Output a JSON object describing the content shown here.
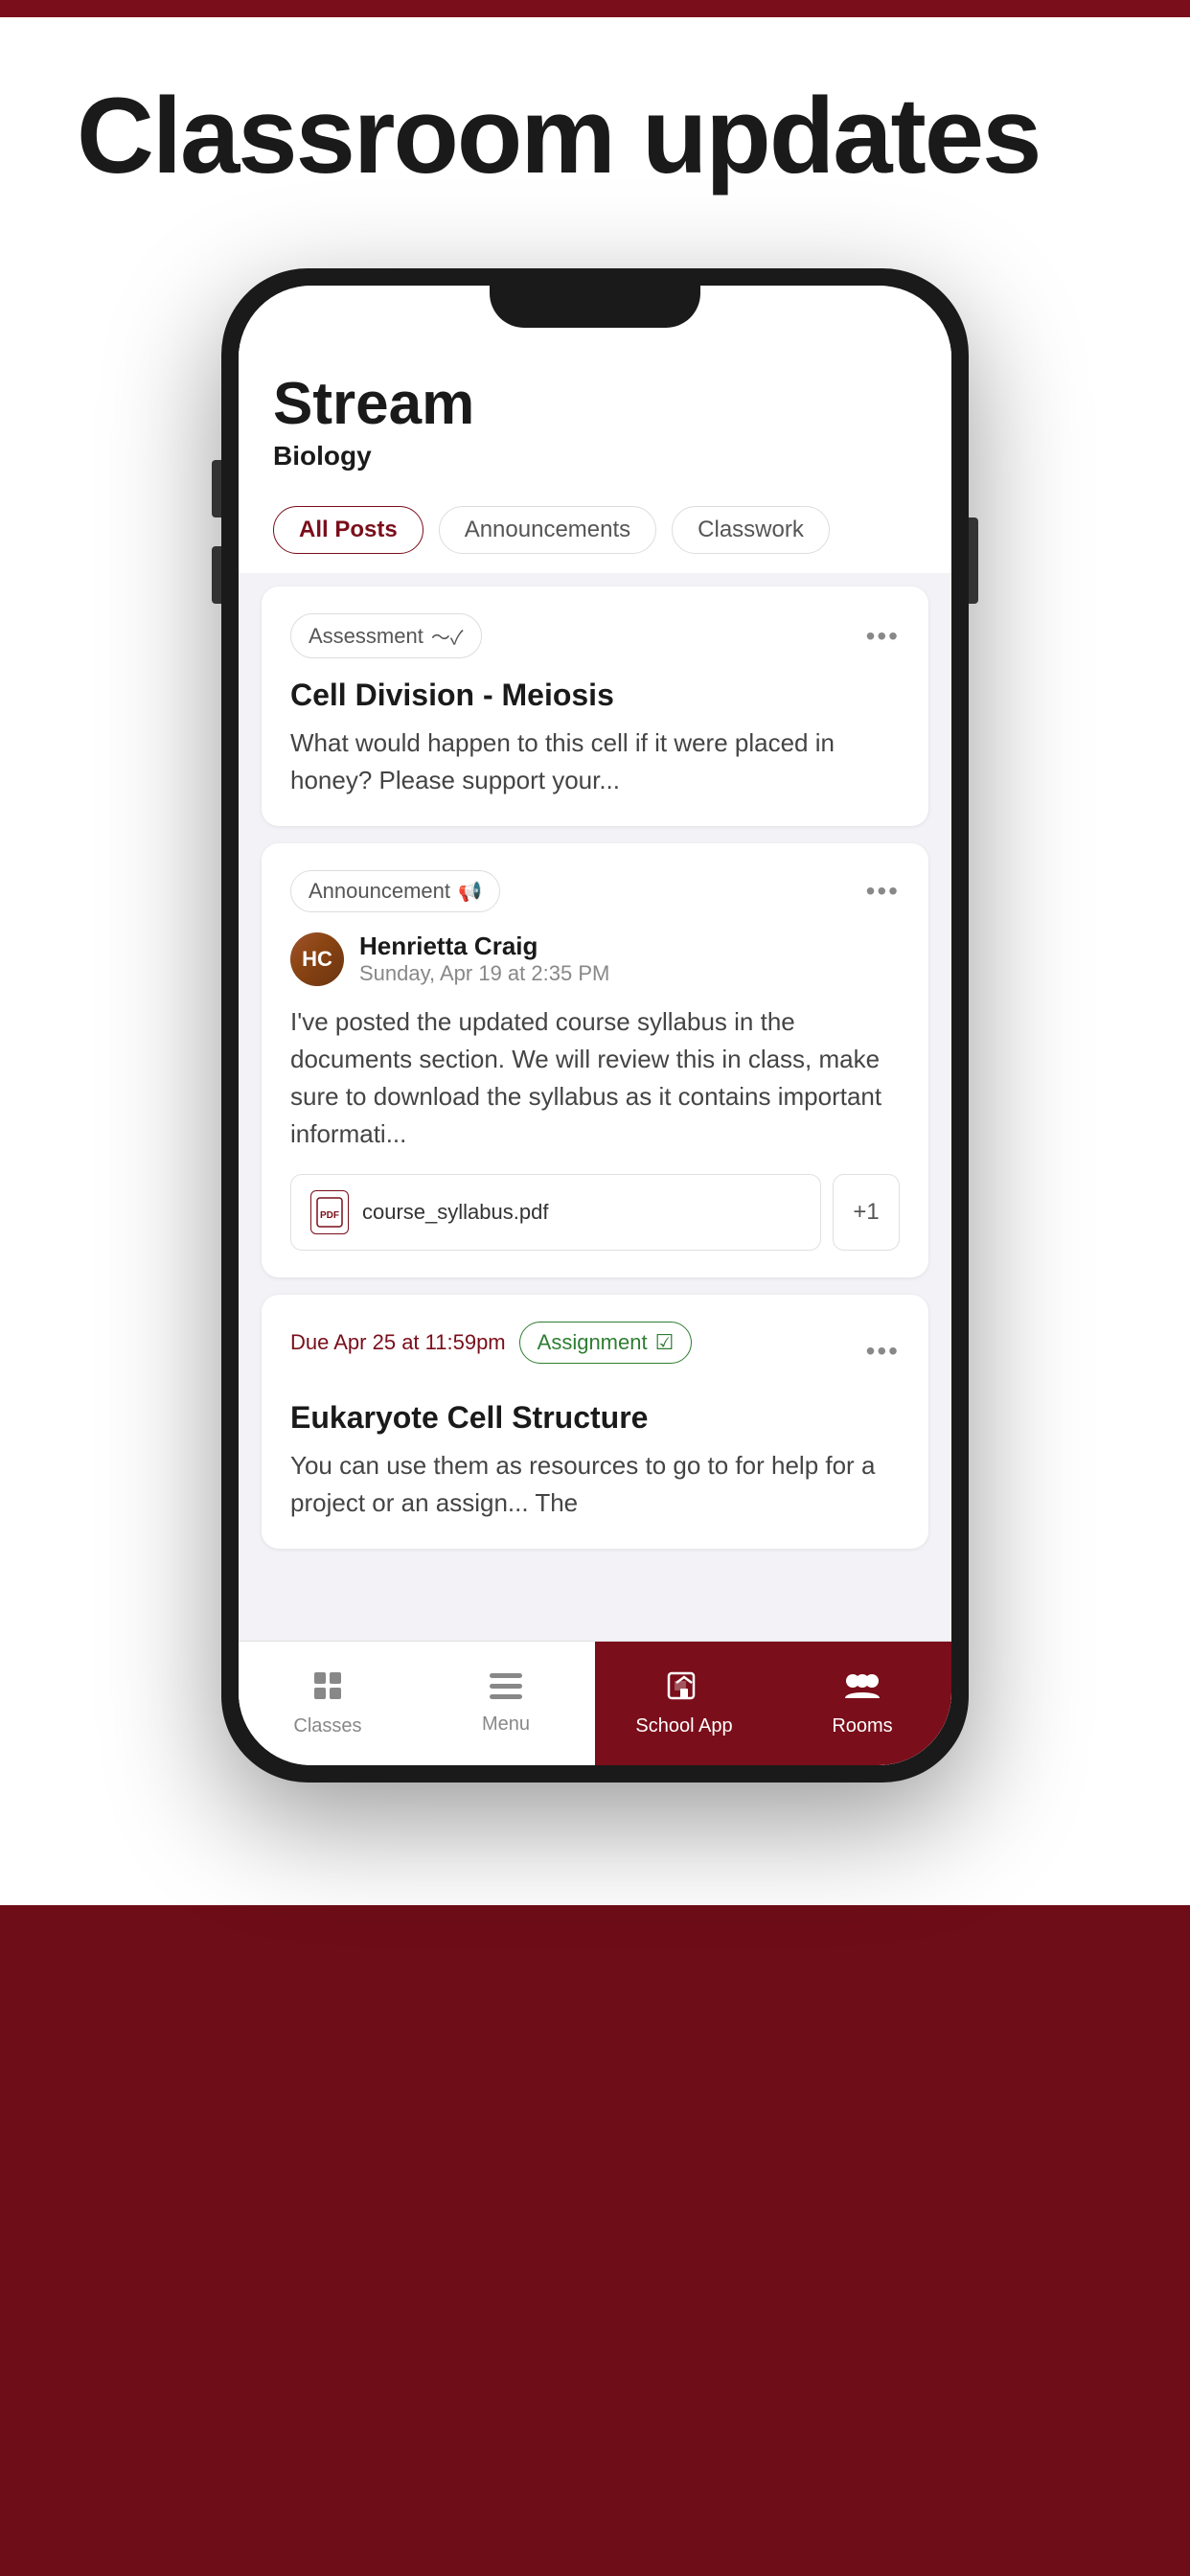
{
  "page": {
    "title": "Classroom updates",
    "bg_top_color": "#7a0e1a",
    "bg_bottom_color": "#6e0d18"
  },
  "stream": {
    "title": "Stream",
    "subtitle": "Biology"
  },
  "tabs": [
    {
      "label": "All Posts",
      "active": true
    },
    {
      "label": "Announcements",
      "active": false
    },
    {
      "label": "Classwork",
      "active": false
    }
  ],
  "cards": [
    {
      "type": "assessment",
      "badge_label": "Assessment",
      "title": "Cell Division - Meiosis",
      "body": "What would happen to this cell if it were placed in honey? Please support your..."
    },
    {
      "type": "announcement",
      "badge_label": "Announcement",
      "author_name": "Henrietta Craig",
      "author_date": "Sunday, Apr 19 at 2:35 PM",
      "body": "I've posted the updated course syllabus in the documents section. We will review this in class, make sure to download the syllabus as it contains important informati...",
      "attachment_name": "course_syllabus.pdf",
      "attachment_count": "+1"
    },
    {
      "type": "assignment",
      "due_label": "Due Apr 25 at 11:59pm",
      "badge_label": "Assignment",
      "title": "Eukaryote Cell Structure",
      "body": "You can use them as resources to go to for help for a project or an assign... The"
    }
  ],
  "bottom_nav": [
    {
      "label": "Classes",
      "icon": "classes",
      "active": false
    },
    {
      "label": "Menu",
      "icon": "menu",
      "active": false
    },
    {
      "label": "School App",
      "icon": "school-app",
      "active": true
    },
    {
      "label": "Rooms",
      "icon": "rooms",
      "active": true
    }
  ]
}
